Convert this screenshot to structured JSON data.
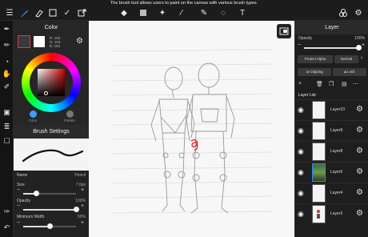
{
  "tooltip": "The brush tool allows users to paint on the canvas with various brush types.",
  "toolbar": {
    "icons": [
      "menu-icon",
      "brush-icon",
      "eraser-icon",
      "rectangle-select-icon",
      "checkmark-icon",
      "transform-icon",
      "fill-bucket-icon",
      "gradient-icon",
      "blur-icon",
      "magic-wand-icon",
      "lasso-icon",
      "text-icon",
      "layers-3d-icon"
    ]
  },
  "color_panel": {
    "title": "Color",
    "rgb": {
      "r": "R: 153",
      "g": "G: 153",
      "b": "B: 153"
    },
    "tabs": [
      "Color",
      "Palette"
    ]
  },
  "brush_panel": {
    "title": "Brush Settings",
    "name_label": "Name",
    "name_value": "Pencil",
    "size_label": "Size",
    "size_value": "7.0px",
    "size_fraction": 0.25,
    "opacity_label": "Opacity",
    "opacity_value": "100%",
    "opacity_fraction": 1.0,
    "minwidth_label": "Minimum Width",
    "minwidth_value": "50%",
    "minwidth_fraction": 0.5
  },
  "layer_panel": {
    "title": "Layer",
    "opacity_label": "Opacity",
    "opacity_value": "100%",
    "opacity_fraction": 1.0,
    "protect_alpha": "Protect Alpha",
    "blend_mode": "Normal",
    "clipping": "Clipping",
    "lock": "Lock",
    "list_title": "Layer List",
    "layers": [
      {
        "name": "Layer10",
        "thumb": "blank"
      },
      {
        "name": "Layer9",
        "thumb": "blank"
      },
      {
        "name": "Layer8",
        "thumb": "blank"
      },
      {
        "name": "Layer5",
        "thumb": "photo"
      },
      {
        "name": "Layer4",
        "thumb": "blank"
      },
      {
        "name": "Layer3",
        "thumb": "figure"
      }
    ]
  },
  "accent_color": "#2b8cff"
}
